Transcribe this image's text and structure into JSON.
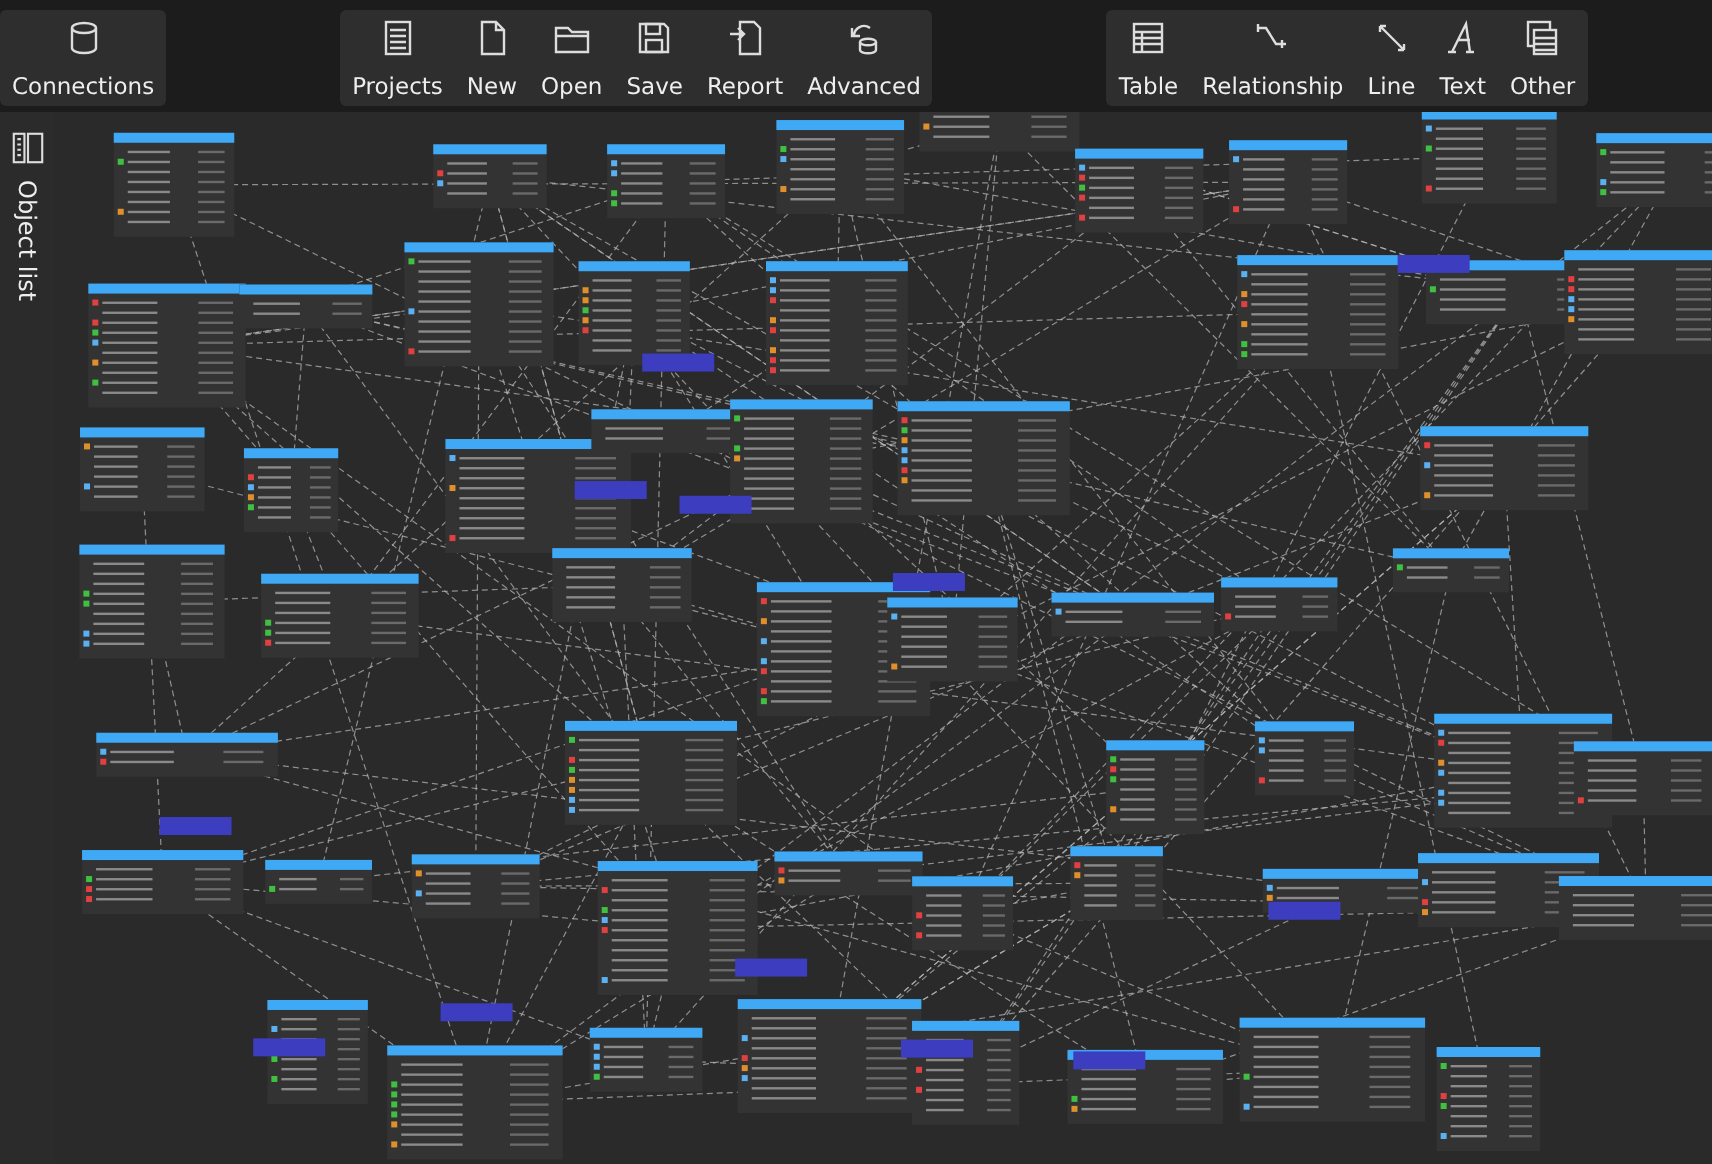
{
  "toolbar": {
    "groups": [
      {
        "buttons": [
          {
            "label": "Connections",
            "kind": "database"
          }
        ]
      },
      {
        "buttons": [
          {
            "label": "Projects",
            "kind": "projects"
          },
          {
            "label": "New",
            "kind": "page"
          },
          {
            "label": "Open",
            "kind": "folder"
          },
          {
            "label": "Save",
            "kind": "disk"
          },
          {
            "label": "Report",
            "kind": "report"
          },
          {
            "label": "Advanced",
            "kind": "advanced"
          }
        ]
      },
      {
        "buttons": [
          {
            "label": "Table",
            "kind": "table"
          },
          {
            "label": "Relationship",
            "kind": "relationship"
          },
          {
            "label": "Line",
            "kind": "line"
          },
          {
            "label": "Text",
            "kind": "text"
          },
          {
            "label": "Other",
            "kind": "other"
          }
        ]
      }
    ]
  },
  "sidebar": {
    "label": "Object list"
  }
}
